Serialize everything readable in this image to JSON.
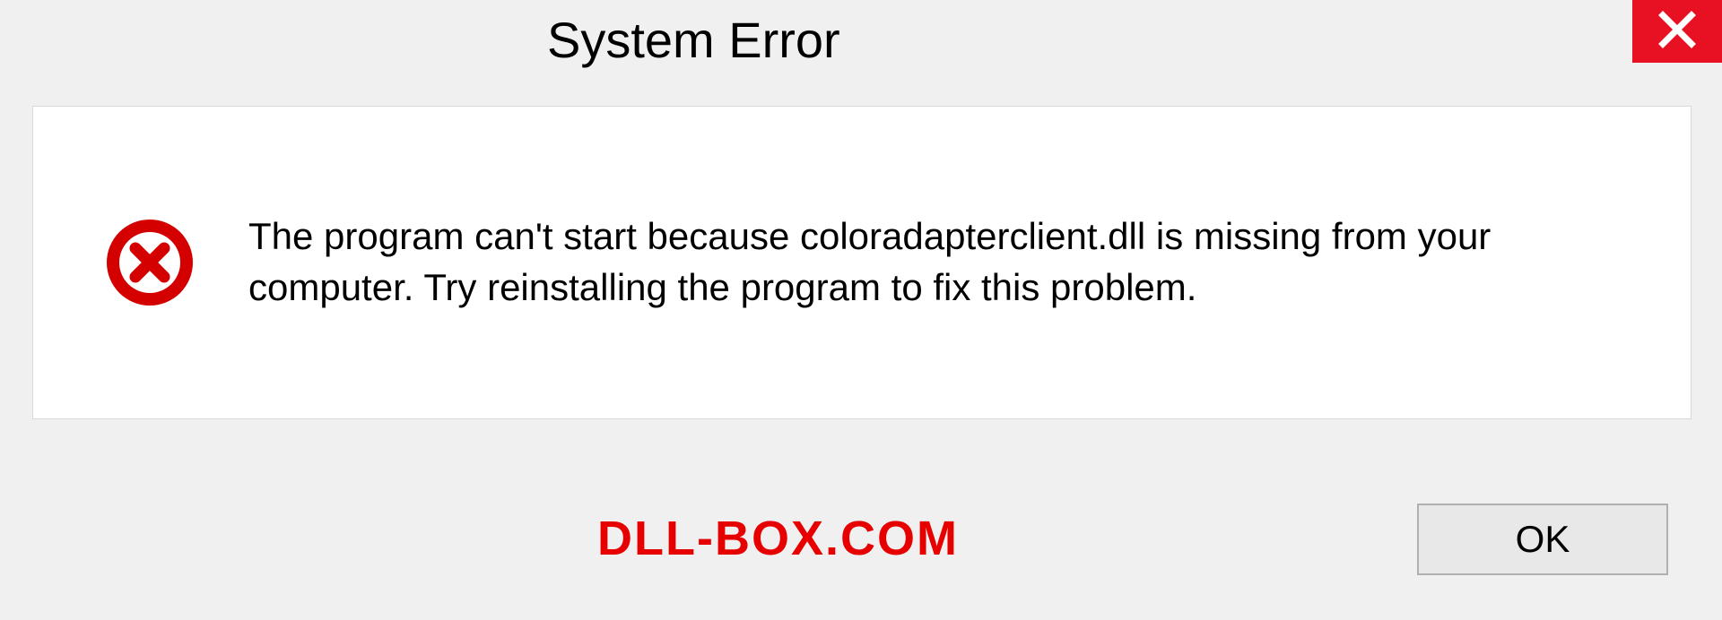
{
  "dialog": {
    "title": "System Error",
    "message": "The program can't start because coloradapterclient.dll is missing from your computer. Try reinstalling the program to fix this problem.",
    "ok_label": "OK"
  },
  "watermark": "DLL-BOX.COM",
  "colors": {
    "close_bg": "#e81123",
    "error_icon": "#d40000",
    "watermark": "#e60000"
  }
}
